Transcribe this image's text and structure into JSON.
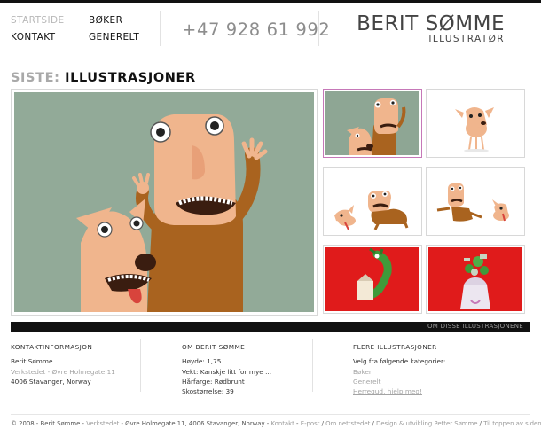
{
  "nav": {
    "col1": [
      {
        "label": "STARTSIDE",
        "muted": true
      },
      {
        "label": "KONTAKT",
        "muted": false
      }
    ],
    "col2": [
      {
        "label": "BØKER",
        "muted": false
      },
      {
        "label": "GENERELT",
        "muted": false
      }
    ]
  },
  "phone": "+47 928 61 992",
  "logo": {
    "name": "BERIT SØMME",
    "sub": "ILLUSTRATØR"
  },
  "section": {
    "prefix": "SISTE:",
    "title": "ILLUSTRASJONER"
  },
  "gallery": {
    "main_image": "illustration-man-and-dog",
    "thumbs": [
      {
        "name": "thumb-man-and-dog",
        "active": true,
        "bg": "#8ea694"
      },
      {
        "name": "thumb-dog",
        "active": false,
        "bg": "#ffffff"
      },
      {
        "name": "thumb-man-and-dog-running",
        "active": false,
        "bg": "#ffffff"
      },
      {
        "name": "thumb-man-chasing-dog",
        "active": false,
        "bg": "#ffffff"
      },
      {
        "name": "thumb-crocodile",
        "active": false,
        "bg": "#e01b1b"
      },
      {
        "name": "thumb-money-bag",
        "active": false,
        "bg": "#e01b1b"
      }
    ],
    "about_link": "OM DISSE ILLUSTRASJONENE"
  },
  "footer_cols": {
    "contact": {
      "heading": "KONTAKTINFORMASJON",
      "name": "Berit Sømme",
      "address_link": "Verkstedet - Øvre Holmegate 11",
      "city": "4006 Stavanger, Norway"
    },
    "about": {
      "heading": "OM BERIT SØMME",
      "lines": [
        "Høyde: 1,75",
        "Vekt: Kanskje litt for mye ...",
        "Hårfarge: Rødbrunt",
        "Skostørrelse: 39"
      ]
    },
    "more": {
      "heading": "FLERE ILLUSTRASJONER",
      "intro": "Velg fra følgende kategorier:",
      "categories": [
        "Bøker",
        "Generelt"
      ],
      "help": "Herregud, hjelp meg!"
    }
  },
  "footer": {
    "copyright": "© 2008 - Berit Sømme - ",
    "address_link": "Verkstedet",
    "address_rest": " - Øvre Holmegate 11, 4006 Stavanger, Norway - ",
    "contact_link": "Kontakt",
    "sep1": " - ",
    "epost_link": "E-post",
    "sep2": " / ",
    "about_site_link": "Om nettstedet",
    "sep3": " / ",
    "design_link": "Design & utvikling Petter Sømme",
    "sep4": " / ",
    "top_link": "Til toppen av siden"
  },
  "colors": {
    "accent_red": "#e01b1b",
    "background_green": "#8ea694",
    "active_border": "#c678b8"
  }
}
